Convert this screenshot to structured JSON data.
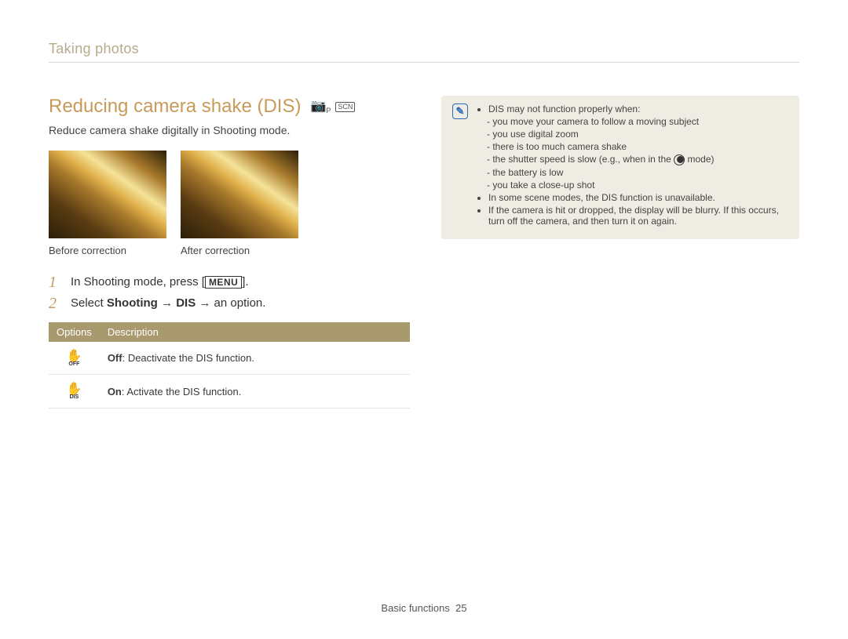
{
  "breadcrumb": "Taking photos",
  "title": "Reducing camera shake (DIS)",
  "mode_icons": [
    "camera-p-icon",
    "scn-icon"
  ],
  "intro": "Reduce camera shake digitally in Shooting mode.",
  "photos": {
    "before_caption": "Before correction",
    "after_caption": "After correction"
  },
  "steps": [
    {
      "pre": "In Shooting mode, press [",
      "key": "MENU",
      "post": "]."
    },
    {
      "pre": "Select ",
      "bold1": "Shooting",
      "mid": " → ",
      "bold2": "DIS",
      "post": " → an option."
    }
  ],
  "table": {
    "headers": {
      "col1": "Options",
      "col2": "Description"
    },
    "rows": [
      {
        "icon_label": "OFF",
        "name_bold": "Off",
        "desc": ": Deactivate the DIS function."
      },
      {
        "icon_label": "DIS",
        "name_bold": "On",
        "desc": ": Activate the DIS function."
      }
    ]
  },
  "note": {
    "lead": "DIS may not function properly when:",
    "sub": [
      "you move your camera to follow a moving subject",
      "you use digital zoom",
      "there is too much camera shake",
      "the shutter speed is slow (e.g., when in the ",
      "the battery is low",
      "you take a close-up shot"
    ],
    "shutter_tail": " mode)",
    "bullets_after": [
      "In some scene modes, the DIS function is unavailable.",
      "If the camera is hit or dropped, the display will be blurry. If this occurs, turn off the camera, and then turn it on again."
    ]
  },
  "footer": {
    "section": "Basic functions",
    "page": "25"
  }
}
